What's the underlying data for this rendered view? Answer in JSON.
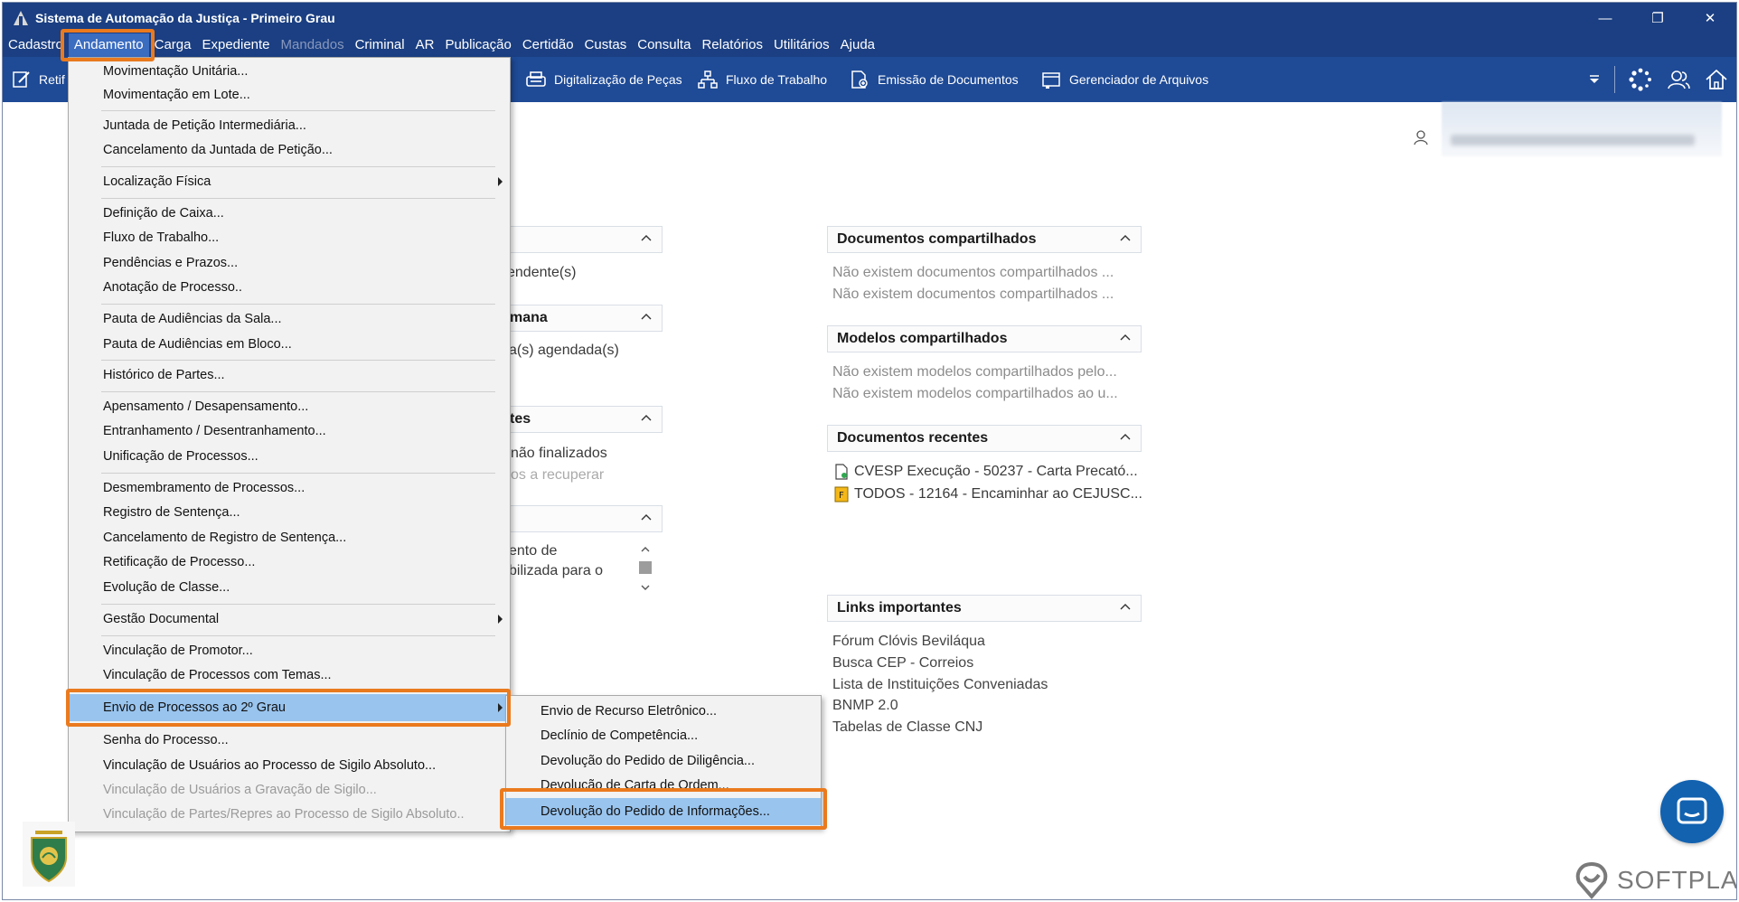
{
  "window": {
    "title": "Sistema de Automação da Justiça - Primeiro Grau",
    "minimize_glyph": "—",
    "restore_glyph": "❐",
    "close_glyph": "✕"
  },
  "menubar": {
    "items": [
      "Cadastro",
      "Andamento",
      "Carga",
      "Expediente",
      "Mandados",
      "Criminal",
      "AR",
      "Publicação",
      "Certidão",
      "Custas",
      "Consulta",
      "Relatórios",
      "Utilitários",
      "Ajuda"
    ],
    "active": "Andamento",
    "disabled": [
      "Mandados"
    ]
  },
  "toolbar": {
    "left_partial": "Retif",
    "items": [
      "Digitalização de Peças",
      "Fluxo de Trabalho",
      "Emissão de Documentos",
      "Gerenciador de Arquivos"
    ]
  },
  "andamento_menu": {
    "items": [
      {
        "label": "Movimentação Unitária..."
      },
      {
        "label": "Movimentação em Lote..."
      },
      {
        "label": "Juntada de Petição Intermediária..."
      },
      {
        "label": "Cancelamento da Juntada de Petição..."
      },
      {
        "label": "Localização Física"
      },
      {
        "label": "Definição de Caixa..."
      },
      {
        "label": "Fluxo de Trabalho..."
      },
      {
        "label": "Pendências e Prazos..."
      },
      {
        "label": "Anotação de Processo.."
      },
      {
        "label": "Pauta de Audiências da Sala..."
      },
      {
        "label": "Pauta de Audiências em Bloco..."
      },
      {
        "label": "Histórico de Partes..."
      },
      {
        "label": "Apensamento / Desapensamento..."
      },
      {
        "label": "Entranhamento / Desentranhamento..."
      },
      {
        "label": "Unificação de Processos..."
      },
      {
        "label": "Desmembramento de Processos..."
      },
      {
        "label": "Registro de Sentença..."
      },
      {
        "label": "Cancelamento de Registro de Sentença..."
      },
      {
        "label": "Retificação de Processo..."
      },
      {
        "label": "Evolução de Classe..."
      },
      {
        "label": "Gestão Documental"
      },
      {
        "label": "Vinculação de Promotor..."
      },
      {
        "label": "Vinculação de Processos com Temas..."
      },
      {
        "label": "Envio de Processos ao 2º Grau"
      },
      {
        "label": "Senha do Processo..."
      },
      {
        "label": "Vinculação de Usuários ao Processo de Sigilo Absoluto..."
      },
      {
        "label": "Vinculação de Usuários a Gravação de Sigilo..."
      },
      {
        "label": "Vinculação de Partes/Repres ao Processo de Sigilo Absoluto.."
      }
    ],
    "highlighted": "Envio de Processos ao 2º Grau"
  },
  "submenu": {
    "items": [
      "Envio de Recurso Eletrônico...",
      "Declínio de Competência...",
      "Devolução do Pedido de Diligência...",
      "Devolução de Carta de Ordem...",
      "Devolução do Pedido de Informações..."
    ],
    "highlighted": "Devolução do Pedido de Informações..."
  },
  "left_panels": {
    "fragments": [
      "endente(s)",
      "mana",
      "a(s) agendada(s)",
      "tes",
      "não finalizados",
      "os a recuperar",
      "ento de",
      "bilizada para o"
    ]
  },
  "right_panels": {
    "documentos_compartilhados": {
      "title": "Documentos compartilhados",
      "lines": [
        "Não existem documentos compartilhados ...",
        "Não existem documentos compartilhados ..."
      ]
    },
    "modelos_compartilhados": {
      "title": "Modelos compartilhados",
      "lines": [
        "Não existem modelos compartilhados pelo...",
        "Não existem modelos compartilhados ao u..."
      ]
    },
    "documentos_recentes": {
      "title": "Documentos recentes",
      "items": [
        "CVESP Execução - 50237 - Carta Precató...",
        "TODOS - 12164 - Encaminhar ao CEJUSC..."
      ]
    },
    "links_importantes": {
      "title": "Links importantes",
      "links": [
        "Fórum Clóvis Beviláqua",
        "Busca CEP - Correios",
        "Lista de Instituições Conveniadas",
        "BNMP 2.0",
        "Tabelas de Classe CNJ"
      ]
    }
  },
  "branding": {
    "softplan": "SOFTPLAN"
  },
  "colors": {
    "titlebar": "#1b3f82",
    "toolbar": "#1e4a96",
    "highlight": "#99c4ee",
    "annotation": "#ea7a1e",
    "chat_button": "#1262b0"
  }
}
